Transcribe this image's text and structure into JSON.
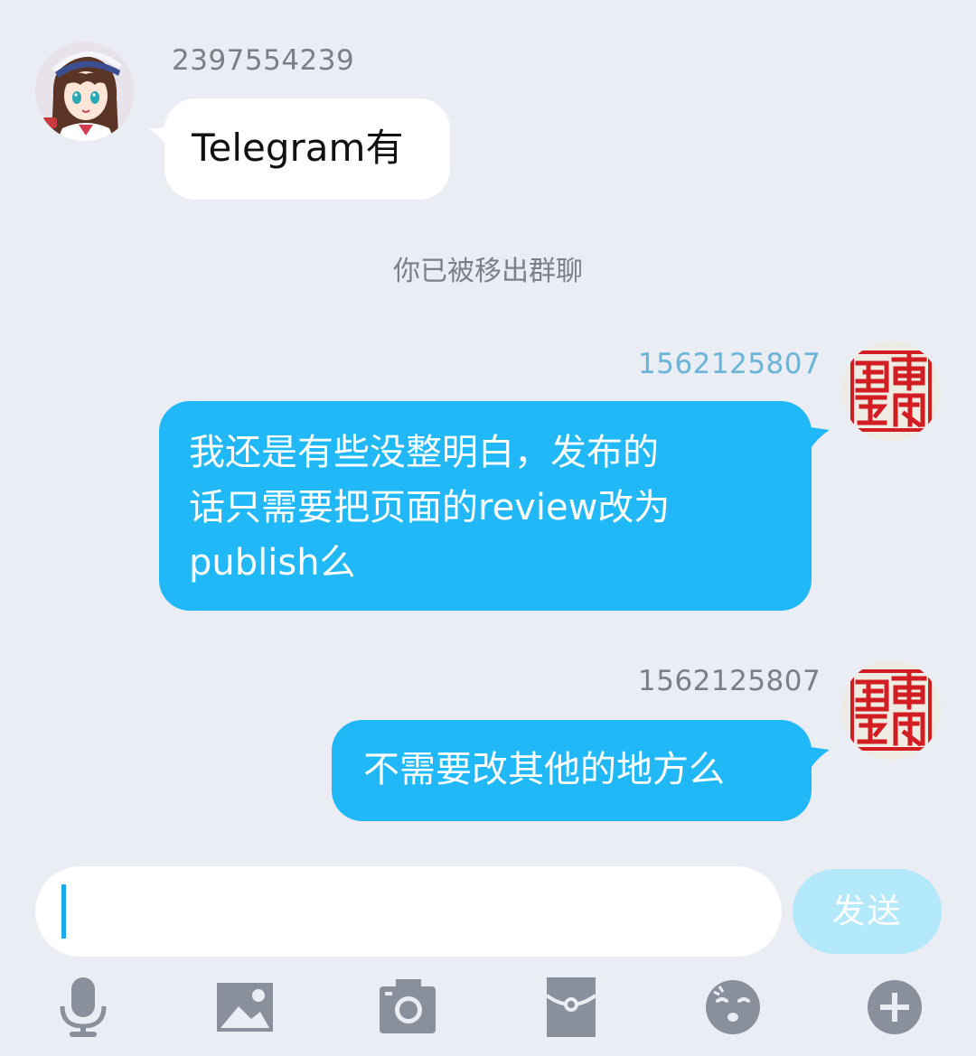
{
  "messages": [
    {
      "sender": "2397554239",
      "text": "Telegram有"
    },
    {
      "system": "你已被移出群聊"
    },
    {
      "sender": "1562125807",
      "text": "我还是有些没整明白，发布的\n话只需要把页面的review改为\npublish么"
    },
    {
      "sender": "1562125807",
      "text": "不需要改其他的地方么"
    }
  ],
  "composer": {
    "send_label": "发送",
    "value": ""
  },
  "toolbar": {
    "icons": [
      "microphone-icon",
      "image-icon",
      "camera-icon",
      "red-packet-icon",
      "emoji-icon",
      "plus-icon"
    ]
  },
  "colors": {
    "background": "#eaedf3",
    "outgoing_bubble": "#20b8f7",
    "incoming_bubble": "#ffffff",
    "send_button_disabled": "#b3e9fb",
    "caret": "#1aa9ec",
    "icon": "#8a8f9c"
  }
}
